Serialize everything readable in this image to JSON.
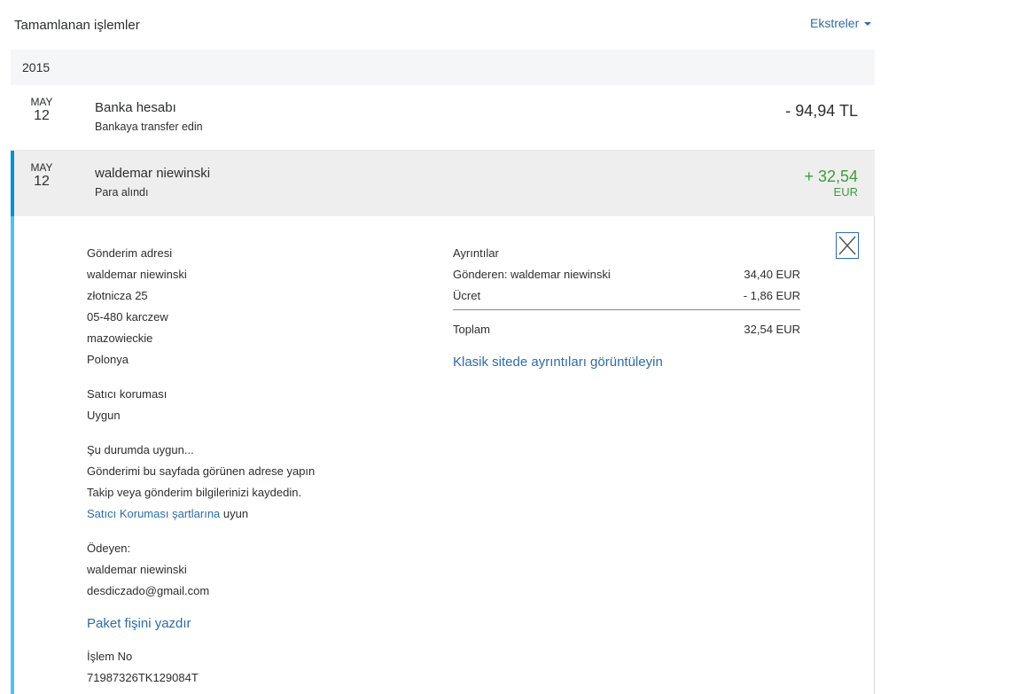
{
  "header": {
    "title": "Tamamlanan işlemler",
    "statements_label": "Ekstreler"
  },
  "year": "2015",
  "transactions": [
    {
      "month": "MAY",
      "day": "12",
      "title": "Banka hesabı",
      "subtitle": "Bankaya transfer edin",
      "amount": "- 94,94 TL",
      "currency": ""
    },
    {
      "month": "MAY",
      "day": "12",
      "title": "waldemar niewinski",
      "subtitle": "Para alındı",
      "amount": "+ 32,54",
      "currency": "EUR"
    }
  ],
  "detail": {
    "shipping": {
      "label": "Gönderim adresi",
      "lines": [
        "waldemar niewinski",
        "złotnicza 25",
        "05-480 karczew",
        "mazowieckie",
        "Polonya"
      ]
    },
    "seller_protection": {
      "label": "Satıcı koruması",
      "value": "Uygun"
    },
    "eligible": {
      "label": "Şu durumda uygun...",
      "line1": "Gönderimi bu sayfada görünen adrese yapın",
      "line2": "Takip veya gönderim bilgilerinizi kaydedin.",
      "terms_link": "Satıcı Koruması şartlarına",
      "terms_suffix": " uyun"
    },
    "payer": {
      "label": "Ödeyen:",
      "name": "waldemar niewinski",
      "email": "desdiczado@gmail.com"
    },
    "print_label": "Paket fişini yazdır",
    "transaction_id": {
      "label": "İşlem No",
      "value": "71987326TK129084T"
    },
    "breakdown": {
      "title": "Ayrıntılar",
      "rows": [
        {
          "label": "Gönderen: waldemar niewinski",
          "value": "34,40 EUR"
        },
        {
          "label": "Ücret",
          "value": "- 1,86 EUR"
        }
      ],
      "total_label": "Toplam",
      "total_value": "32,54 EUR",
      "classic_link": "Klasik sitede ayrıntıları görüntüleyin"
    }
  },
  "colors": {
    "link": "#2c6ca8",
    "positive": "#3e9d3e",
    "accent_bar": "#0a8fd6",
    "detail_bar": "#4fc1f0"
  }
}
